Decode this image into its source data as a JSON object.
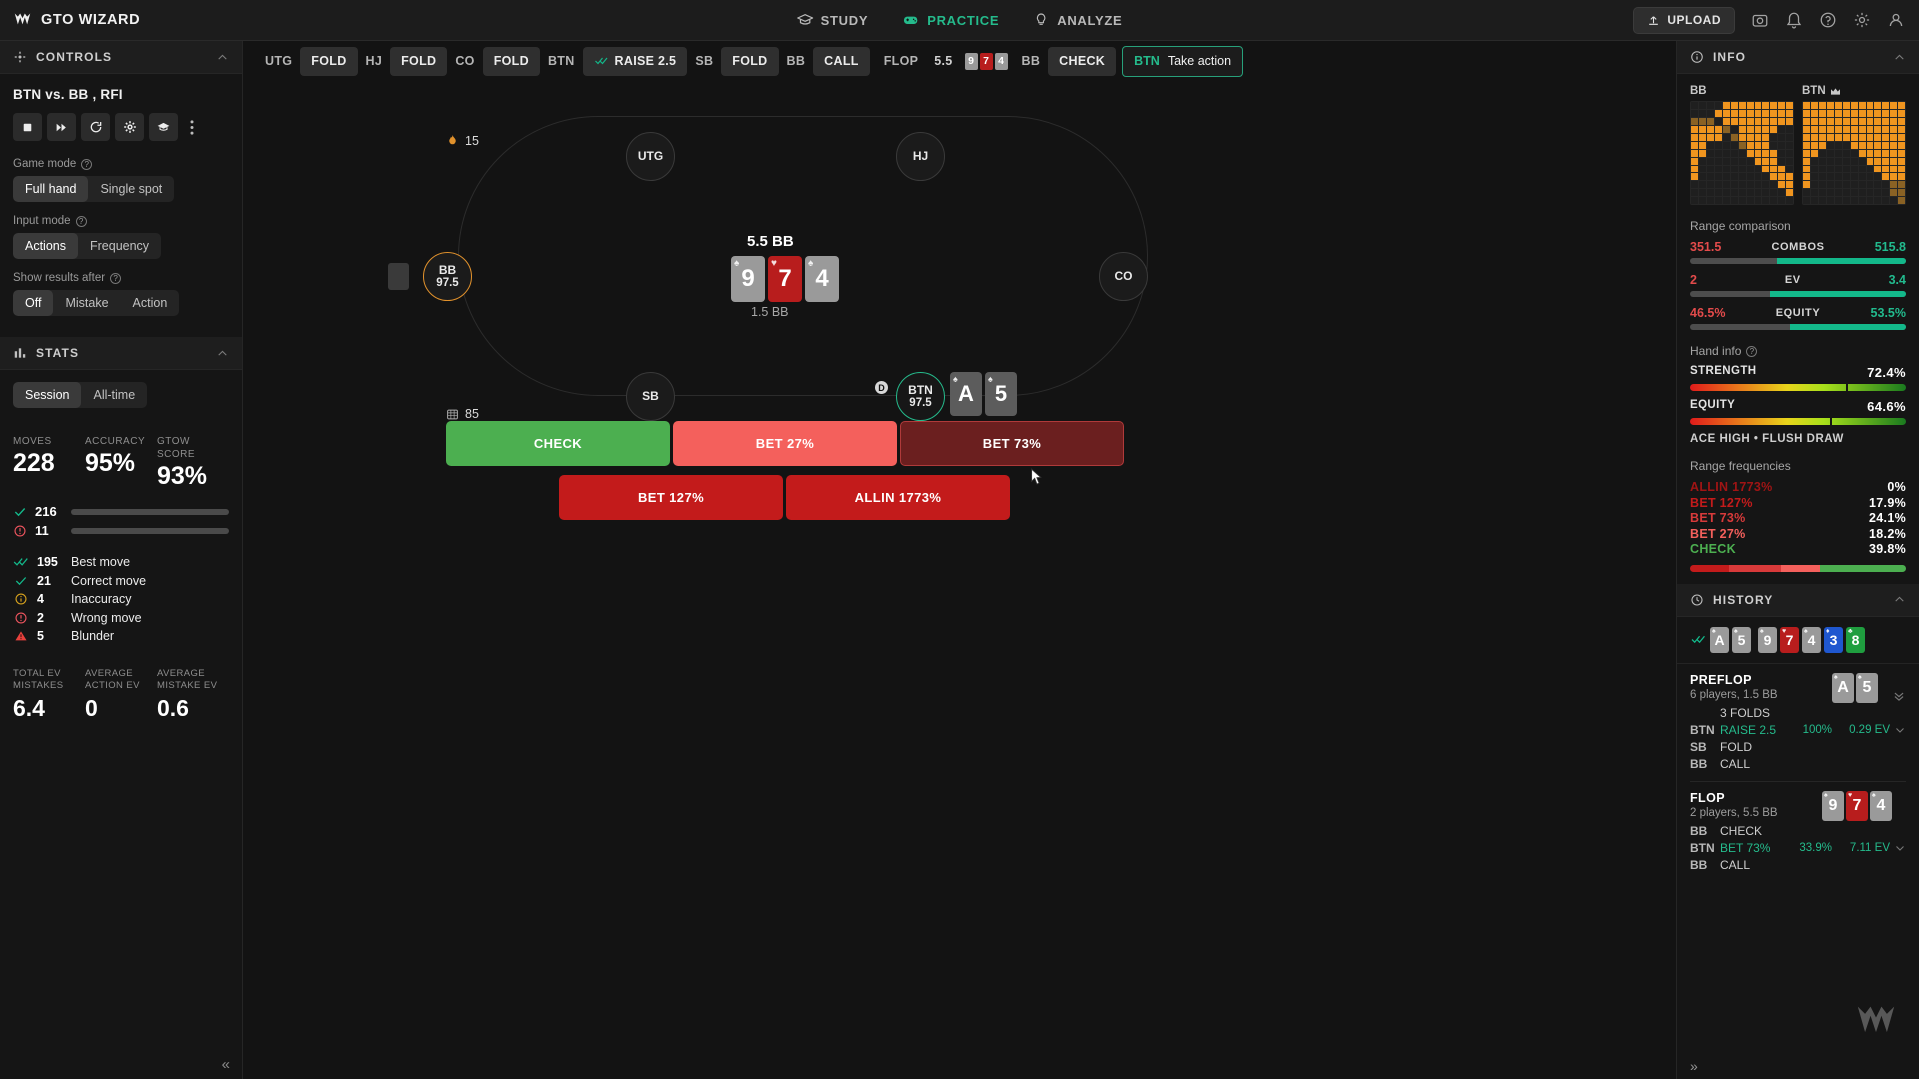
{
  "header": {
    "brand": "GTO WIZARD",
    "nav": [
      {
        "label": "STUDY",
        "icon": "graduation-cap-icon",
        "active": false
      },
      {
        "label": "PRACTICE",
        "icon": "gamepad-icon",
        "active": true
      },
      {
        "label": "ANALYZE",
        "icon": "lightbulb-icon",
        "active": false
      }
    ],
    "upload_label": "UPLOAD",
    "icons": [
      "camera-icon",
      "bell-icon",
      "help-icon",
      "settings-icon",
      "account-icon"
    ]
  },
  "controls": {
    "panel_title": "CONTROLS",
    "spot_title": "BTN vs. BB , RFI",
    "tool_icons": [
      "stop-icon",
      "fast-forward-icon",
      "refresh-icon",
      "gear-icon",
      "study-icon",
      "more-icon"
    ],
    "game_mode": {
      "label": "Game mode",
      "options": [
        "Full hand",
        "Single spot"
      ],
      "selected": "Full hand"
    },
    "input_mode": {
      "label": "Input mode",
      "options": [
        "Actions",
        "Frequency"
      ],
      "selected": "Actions"
    },
    "show_results": {
      "label": "Show results after",
      "options": [
        "Off",
        "Mistake",
        "Action"
      ],
      "selected": "Off"
    }
  },
  "stats": {
    "panel_title": "STATS",
    "range_options": [
      "Session",
      "All-time"
    ],
    "range_selected": "Session",
    "summary": [
      {
        "caption": "MOVES",
        "value": "228"
      },
      {
        "caption": "ACCURACY",
        "value": "95%"
      },
      {
        "caption": "GTOW SCORE",
        "value": "93%"
      }
    ],
    "bars": [
      {
        "icon": "check-icon",
        "count": "216",
        "pct": 95.0,
        "color": "#13b88a"
      },
      {
        "icon": "alert-icon",
        "count": "11",
        "pct": 4.8,
        "color": "#f0555f"
      }
    ],
    "moves": [
      {
        "icon": "double-check-icon",
        "count": "195",
        "label": "Best move",
        "color": "#13b88a"
      },
      {
        "icon": "check-icon",
        "count": "21",
        "label": "Correct move",
        "color": "#13b88a"
      },
      {
        "icon": "info-icon",
        "count": "4",
        "label": "Inaccuracy",
        "color": "#d8a31e"
      },
      {
        "icon": "alert-icon",
        "count": "2",
        "label": "Wrong move",
        "color": "#f0555f"
      },
      {
        "icon": "warning-icon",
        "count": "5",
        "label": "Blunder",
        "color": "#e8413c"
      }
    ],
    "ev": [
      {
        "caption": "TOTAL EV MISTAKES",
        "value": "6.4"
      },
      {
        "caption": "AVERAGE ACTION EV",
        "value": "0"
      },
      {
        "caption": "AVERAGE MISTAKE EV",
        "value": "0.6"
      }
    ]
  },
  "actionbar": {
    "steps": [
      {
        "pos": "UTG",
        "action": "FOLD",
        "check": false
      },
      {
        "pos": "HJ",
        "action": "FOLD",
        "check": false
      },
      {
        "pos": "CO",
        "action": "FOLD",
        "check": false
      },
      {
        "pos": "BTN",
        "action": "RAISE 2.5",
        "check": true
      },
      {
        "pos": "SB",
        "action": "FOLD",
        "check": false
      },
      {
        "pos": "BB",
        "action": "CALL",
        "check": false
      }
    ],
    "flop_label": "FLOP",
    "flop_pot": "5.5",
    "flop_cards": [
      {
        "rank": "9",
        "suit": "♠",
        "color": "gray"
      },
      {
        "rank": "7",
        "suit": "♥",
        "color": "red"
      },
      {
        "rank": "4",
        "suit": "♠",
        "color": "gray"
      }
    ],
    "bb_pos": "BB",
    "bb_action": "CHECK",
    "take_action": {
      "pos": "BTN",
      "label": "Take action"
    }
  },
  "table": {
    "pot": "5.5 BB",
    "sub_pot": "1.5 BB",
    "board": [
      {
        "rank": "9",
        "suit": "♠",
        "color": "gray"
      },
      {
        "rank": "7",
        "suit": "♥",
        "color": "red"
      },
      {
        "rank": "4",
        "suit": "♠",
        "color": "gray"
      }
    ],
    "seats": [
      {
        "name": "UTG",
        "stack": "",
        "type": "normal"
      },
      {
        "name": "HJ",
        "stack": "",
        "type": "normal"
      },
      {
        "name": "CO",
        "stack": "",
        "type": "normal"
      },
      {
        "name": "SB",
        "stack": "",
        "type": "normal"
      },
      {
        "name": "BB",
        "stack": "97.5",
        "type": "bb"
      },
      {
        "name": "BTN",
        "stack": "97.5",
        "type": "hero"
      }
    ],
    "hero_cards": [
      {
        "rank": "A",
        "suit": "♠"
      },
      {
        "rank": "5",
        "suit": "♠"
      }
    ],
    "dealer_badge": "D",
    "flame_count": "15",
    "deck_count": "85",
    "actions": [
      {
        "label": "CHECK",
        "color": "#4caf50",
        "hovered": false
      },
      {
        "label": "BET 27%",
        "color": "#f4605c",
        "hovered": false
      },
      {
        "label": "BET 73%",
        "color": "#6b1f1f",
        "hovered": true
      },
      {
        "label": "BET 127%",
        "color": "#c31b1b",
        "hovered": false
      },
      {
        "label": "ALLIN 1773%",
        "color": "#c31b1b",
        "hovered": false
      }
    ]
  },
  "info": {
    "panel_title": "INFO",
    "grid_left_label": "BB",
    "grid_right_label": "BTN",
    "range_comparison": {
      "title": "Range comparison",
      "rows": [
        {
          "label": "COMBOS",
          "left": "351.5",
          "right": "515.8",
          "right_pct": 59.5
        },
        {
          "label": "EV",
          "left": "2",
          "right": "3.4",
          "right_pct": 63.0
        },
        {
          "label": "EQUITY",
          "left": "46.5%",
          "right": "53.5%",
          "right_pct": 53.5
        }
      ]
    },
    "hand_info": {
      "title": "Hand info",
      "rows": [
        {
          "label": "STRENGTH",
          "value": "72.4%",
          "pct": 72.4
        },
        {
          "label": "EQUITY",
          "value": "64.6%",
          "pct": 64.6
        }
      ],
      "tags": "ACE HIGH  •  FLUSH DRAW"
    },
    "range_frequencies": {
      "title": "Range frequencies",
      "rows": [
        {
          "label": "ALLIN 1773%",
          "value": "0%",
          "color": "#a01414",
          "pct": 0
        },
        {
          "label": "BET 127%",
          "value": "17.9%",
          "color": "#c31b1b",
          "pct": 17.9
        },
        {
          "label": "BET 73%",
          "value": "24.1%",
          "color": "#d83a3a",
          "pct": 24.1
        },
        {
          "label": "BET 27%",
          "value": "18.2%",
          "color": "#f4605c",
          "pct": 18.2
        },
        {
          "label": "CHECK",
          "value": "39.8%",
          "color": "#4caf50",
          "pct": 39.8
        }
      ]
    }
  },
  "history": {
    "panel_title": "HISTORY",
    "runout": [
      {
        "rank": "A",
        "suit": "♠",
        "color": "gray"
      },
      {
        "rank": "5",
        "suit": "♠",
        "color": "gray"
      },
      {
        "rank": "9",
        "suit": "♠",
        "color": "gray"
      },
      {
        "rank": "7",
        "suit": "♥",
        "color": "red"
      },
      {
        "rank": "4",
        "suit": "♠",
        "color": "gray"
      },
      {
        "rank": "3",
        "suit": "♦",
        "color": "blue"
      },
      {
        "rank": "8",
        "suit": "♣",
        "color": "green"
      }
    ],
    "streets": [
      {
        "name": "PREFLOP",
        "sub": "6 players, 1.5 BB",
        "cards": [
          {
            "rank": "A",
            "suit": "♠",
            "color": "gray"
          },
          {
            "rank": "5",
            "suit": "♠",
            "color": "gray"
          }
        ],
        "folds": "3 FOLDS",
        "actions": [
          {
            "pos": "BTN",
            "name": "RAISE 2.5",
            "freq": "100%",
            "ev": "0.29 EV",
            "teal": true
          },
          {
            "pos": "SB",
            "name": "FOLD",
            "freq": "",
            "ev": "",
            "teal": false
          },
          {
            "pos": "BB",
            "name": "CALL",
            "freq": "",
            "ev": "",
            "teal": false
          }
        ]
      },
      {
        "name": "FLOP",
        "sub": "2 players, 5.5 BB",
        "cards": [
          {
            "rank": "9",
            "suit": "♠",
            "color": "gray"
          },
          {
            "rank": "7",
            "suit": "♥",
            "color": "red"
          },
          {
            "rank": "4",
            "suit": "♠",
            "color": "gray"
          }
        ],
        "folds": "",
        "actions": [
          {
            "pos": "BB",
            "name": "CHECK",
            "freq": "",
            "ev": "",
            "teal": false
          },
          {
            "pos": "BTN",
            "name": "BET 73%",
            "freq": "33.9%",
            "ev": "7.11 EV",
            "teal": true
          },
          {
            "pos": "BB",
            "name": "CALL",
            "freq": "",
            "ev": "",
            "teal": false
          }
        ]
      }
    ]
  }
}
